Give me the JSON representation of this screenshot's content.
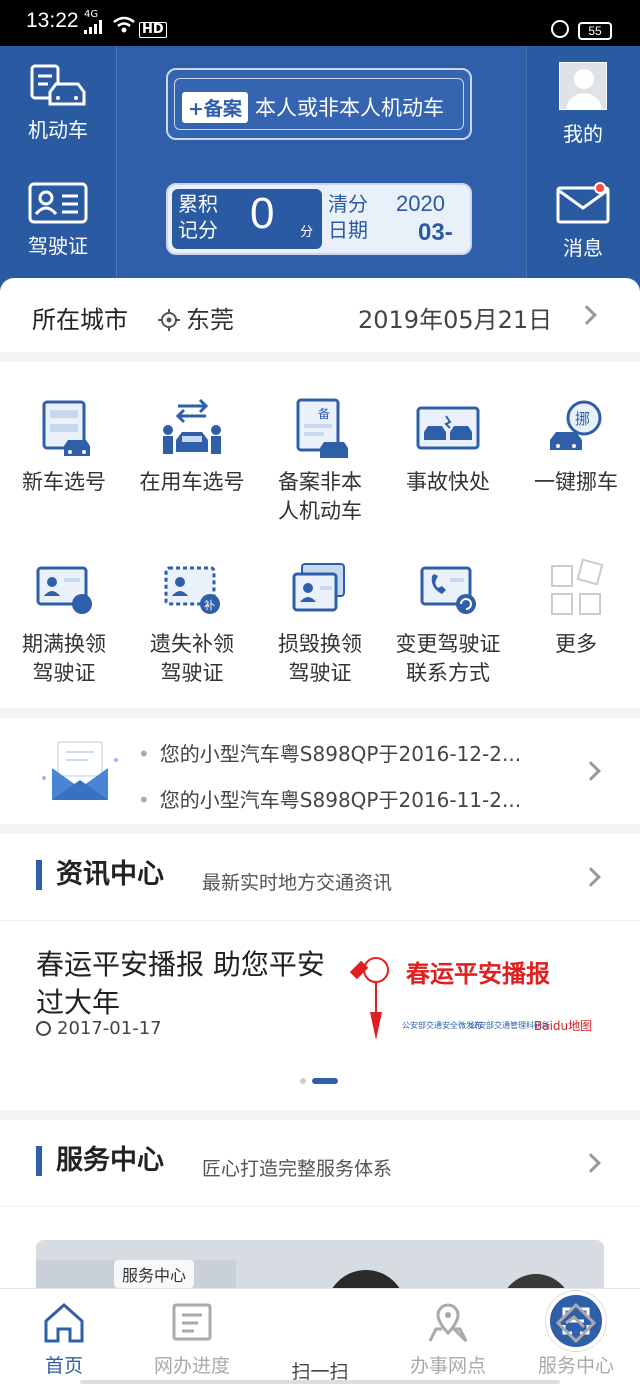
{
  "status_bar": {
    "time": "13:22",
    "network": "4G",
    "hd": "HD",
    "battery": "55"
  },
  "header": {
    "vehicle_label": "机动车",
    "license_label": "驾驶证",
    "plate_tag": "+备案",
    "plate_text": "本人或非本人机动车",
    "mine_label": "我的",
    "message_label": "消息",
    "score_label": "累积记分",
    "score_value": "0",
    "score_unit": "分",
    "clear_label": "清分日期",
    "clear_year": "2020",
    "clear_month": "03-"
  },
  "city": {
    "label": "所在城市",
    "location": "东莞",
    "date": "2019年05月21日"
  },
  "services": [
    {
      "label": "新车选号",
      "icon": "new-plate-icon"
    },
    {
      "label": "在用车选号",
      "icon": "used-car-plate-icon"
    },
    {
      "label": "备案非本人机动车",
      "icon": "register-vehicle-icon"
    },
    {
      "label": "事故快处",
      "icon": "accident-icon"
    },
    {
      "label": "一键挪车",
      "icon": "move-car-icon"
    },
    {
      "label": "期满换领驾驶证",
      "icon": "renew-license-icon"
    },
    {
      "label": "遗失补领驾驶证",
      "icon": "replace-license-icon"
    },
    {
      "label": "损毁换领驾驶证",
      "icon": "damaged-license-icon"
    },
    {
      "label": "变更驾驶证联系方式",
      "icon": "change-contact-icon"
    },
    {
      "label": "更多",
      "icon": "more-icon"
    }
  ],
  "notices": [
    "您的小型汽车粤S898QP于2016-12-2...",
    "您的小型汽车粤S898QP于2016-11-2..."
  ],
  "news": {
    "title": "资讯中心",
    "subtitle": "最新实时地方交通资讯",
    "headline": "春运平安播报 助您平安过大年",
    "date": "2017-01-17",
    "image_text": "春运平安播报",
    "image_logos": [
      "公安部交通安全微发布",
      "公安部交通管理科研所",
      "Baidu地图"
    ]
  },
  "service_center": {
    "title": "服务中心",
    "subtitle": "匠心打造完整服务体系",
    "tag": "服务中心"
  },
  "tabs": [
    {
      "label": "首页",
      "icon": "home-icon"
    },
    {
      "label": "网办进度",
      "icon": "progress-icon"
    },
    {
      "label": "扫一扫",
      "icon": "scan-icon"
    },
    {
      "label": "办事网点",
      "icon": "location-icon"
    },
    {
      "label": "服务中心",
      "icon": "handshake-icon"
    }
  ],
  "colors": {
    "primary": "#2e5fa8",
    "header_dark": "#2a5aa1",
    "badge": "#ff4444",
    "news_red": "#e02020"
  }
}
